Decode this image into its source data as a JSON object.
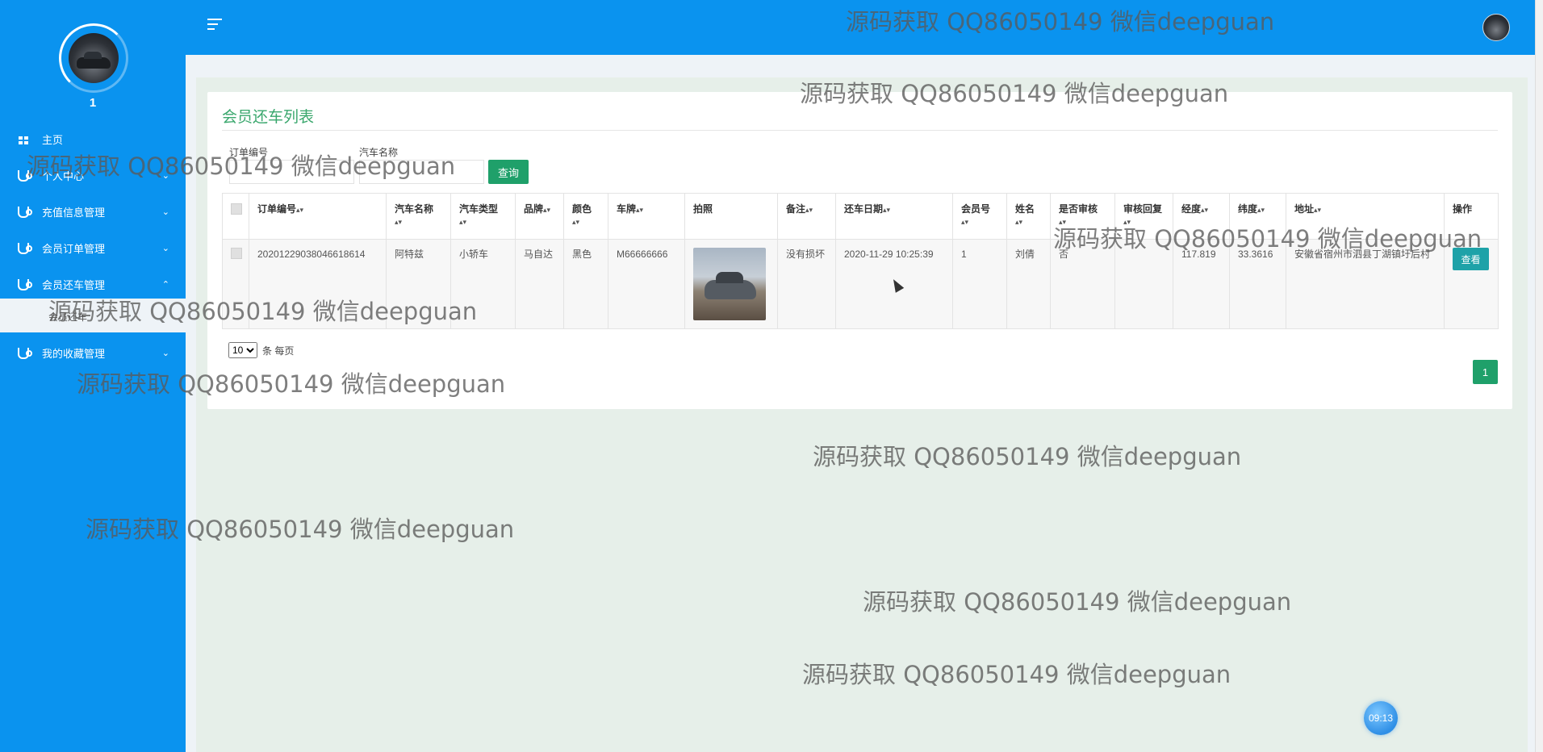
{
  "sidebar": {
    "user_number": "1",
    "items": [
      {
        "label": "主页",
        "icon": "dashboard-icon",
        "chevron": ""
      },
      {
        "label": "个人中心",
        "icon": "stethoscope-icon",
        "chevron": "⌄"
      },
      {
        "label": "充值信息管理",
        "icon": "stethoscope-icon",
        "chevron": "⌄"
      },
      {
        "label": "会员订单管理",
        "icon": "stethoscope-icon",
        "chevron": "⌄"
      },
      {
        "label": "会员还车管理",
        "icon": "stethoscope-icon",
        "chevron": "⌃"
      },
      {
        "label": "我的收藏管理",
        "icon": "stethoscope-icon",
        "chevron": "⌄"
      }
    ],
    "sub_item": "会员还车"
  },
  "header": {
    "menu_icon": "hamburger-icon",
    "avatar_icon": "user-avatar"
  },
  "page": {
    "title": "会员还车列表",
    "filters": {
      "order_label": "订单编号",
      "car_label": "汽车名称",
      "query_button": "查询"
    },
    "table": {
      "headers": [
        "",
        "订单编号",
        "汽车名称",
        "汽车类型",
        "品牌",
        "颜色",
        "车牌",
        "拍照",
        "备注",
        "还车日期",
        "会员号",
        "姓名",
        "是否审核",
        "审核回复",
        "经度",
        "纬度",
        "地址",
        "操作"
      ],
      "sortable": [
        false,
        true,
        true,
        true,
        true,
        true,
        true,
        false,
        true,
        true,
        true,
        true,
        true,
        true,
        true,
        true,
        true,
        false
      ],
      "rows": [
        {
          "order_no": "20201229038046618614",
          "car_name": "阿特兹",
          "car_type": "小轿车",
          "brand": "马自达",
          "color": "黑色",
          "plate": "M66666666",
          "remark": "没有损坏",
          "return_date": "2020-11-29 10:25:39",
          "member_no": "1",
          "name": "刘倩",
          "audited": "否",
          "audit_reply": "",
          "longitude": "117.819",
          "latitude": "33.3616",
          "address": "安徽省宿州市泗县丁湖镇圩后村",
          "action": "查看"
        }
      ]
    },
    "pager": {
      "page_size": "10",
      "page_size_suffix": "条 每页",
      "current_page": "1"
    }
  },
  "clock": "09:13",
  "watermark": "源码获取 QQ86050149 微信deepguan",
  "colors": {
    "primary_blue": "#0a93ef",
    "accent_green": "#1fa06a",
    "view_button": "#1ea2a8"
  }
}
